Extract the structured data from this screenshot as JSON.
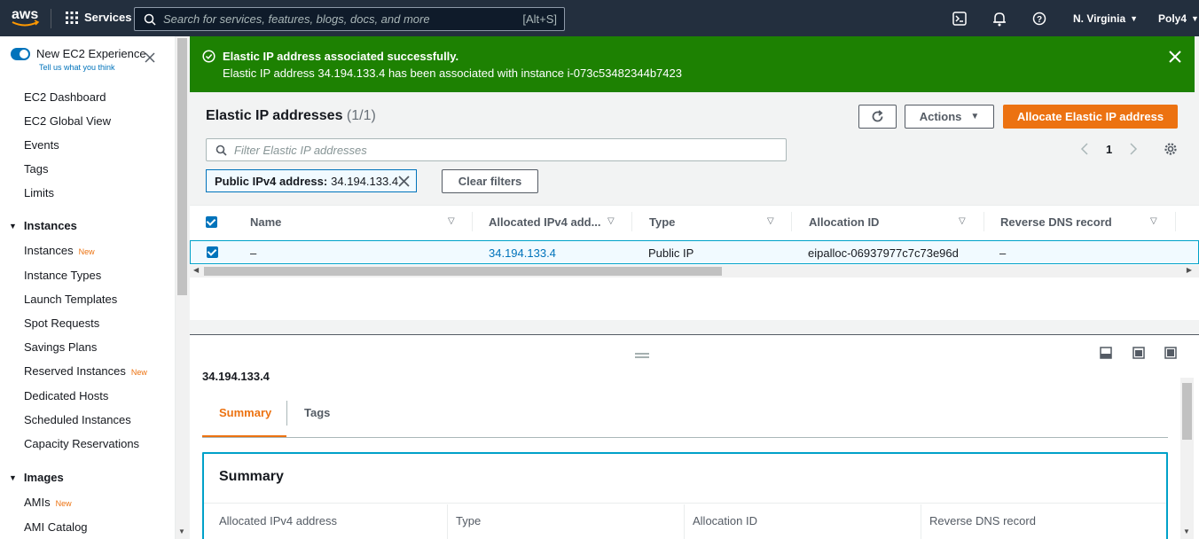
{
  "header": {
    "logo_text": "aws",
    "services_label": "Services",
    "search_placeholder": "Search for services, features, blogs, docs, and more",
    "search_shortcut": "[Alt+S]",
    "region": "N. Virginia",
    "account": "Poly4"
  },
  "sidebar": {
    "experience_title": "New EC2 Experience",
    "experience_link": "Tell us what you think",
    "items_top": [
      "EC2 Dashboard",
      "EC2 Global View",
      "Events",
      "Tags",
      "Limits"
    ],
    "instances_heading": "Instances",
    "instances_items": [
      {
        "label": "Instances",
        "badge": "New"
      },
      {
        "label": "Instance Types",
        "badge": ""
      },
      {
        "label": "Launch Templates",
        "badge": ""
      },
      {
        "label": "Spot Requests",
        "badge": ""
      },
      {
        "label": "Savings Plans",
        "badge": ""
      },
      {
        "label": "Reserved Instances",
        "badge": "New"
      },
      {
        "label": "Dedicated Hosts",
        "badge": ""
      },
      {
        "label": "Scheduled Instances",
        "badge": ""
      },
      {
        "label": "Capacity Reservations",
        "badge": ""
      }
    ],
    "images_heading": "Images",
    "images_items": [
      {
        "label": "AMIs",
        "badge": "New"
      },
      {
        "label": "AMI Catalog",
        "badge": ""
      }
    ]
  },
  "flash": {
    "title": "Elastic IP address associated successfully.",
    "message": "Elastic IP address 34.194.133.4 has been associated with instance i-073c53482344b7423"
  },
  "panel": {
    "title": "Elastic IP addresses",
    "count": "(1/1)",
    "actions_label": "Actions",
    "allocate_label": "Allocate Elastic IP address",
    "filter_placeholder": "Filter Elastic IP addresses",
    "page_number": "1",
    "filter_token": "Public IPv4 address:",
    "filter_token_value": "34.194.133.4",
    "clear_filters_label": "Clear filters"
  },
  "table": {
    "columns": [
      "Name",
      "Allocated IPv4 add...",
      "Type",
      "Allocation ID",
      "Reverse DNS record"
    ],
    "rows": [
      {
        "name": "–",
        "ip": "34.194.133.4",
        "type": "Public IP",
        "allocation_id": "eipalloc-06937977c7c73e96d",
        "reverse_dns": "–"
      }
    ]
  },
  "detail": {
    "title": "34.194.133.4",
    "tabs": [
      "Summary",
      "Tags"
    ],
    "summary_heading": "Summary",
    "summary_columns": [
      "Allocated IPv4 address",
      "Type",
      "Allocation ID",
      "Reverse DNS record"
    ]
  },
  "colors": {
    "topbar": "#232f3e",
    "success": "#1d8102",
    "primary": "#ec7211",
    "link": "#0073bb",
    "selection": "#00a1c9"
  }
}
